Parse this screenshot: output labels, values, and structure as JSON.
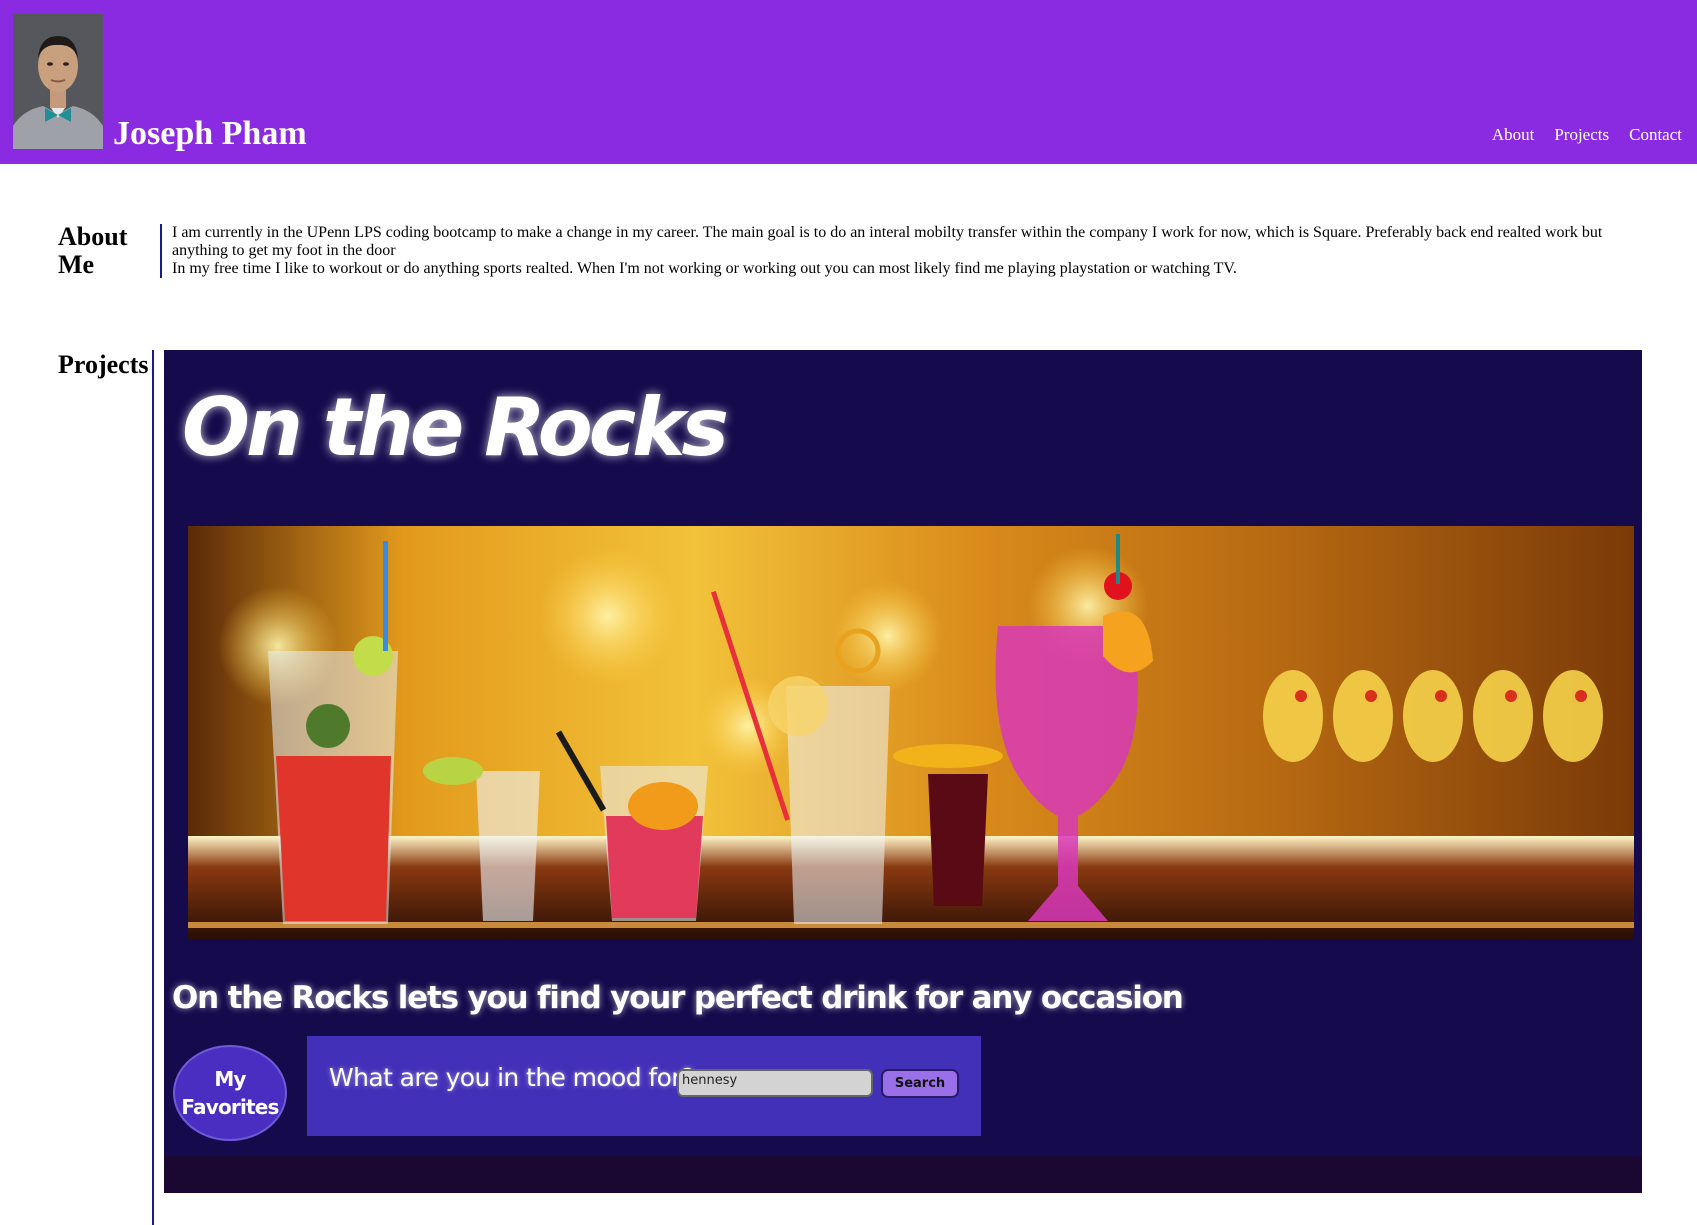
{
  "header": {
    "name": "Joseph Pham",
    "nav": [
      "About",
      "Projects",
      "Contact"
    ]
  },
  "about": {
    "heading": "About Me",
    "paragraphs": [
      "I am currently in the UPenn LPS coding bootcamp to make a change in my career. The main goal is to do an interal mobilty transfer within the company I work for now, which is Square. Preferably back end realted work but anything to get my foot in the door",
      "In my free time I like to workout or do anything sports realted. When I'm not working or working out you can most likely find me playing playstation or watching TV."
    ]
  },
  "projects": {
    "heading": "Projects",
    "items": [
      {
        "title": "On the Rocks",
        "tagline": "On the Rocks lets you find your perfect drink for any occasion",
        "favorites_label": "My Favorites",
        "search_label": "What are you in the mood for?",
        "search_value": "hennesy",
        "search_button": "Search"
      }
    ]
  },
  "colors": {
    "header_bg": "#8a2be2",
    "project_bg": "#140a4c",
    "search_panel": "#4330b8",
    "rule": "#1a1a8a"
  }
}
